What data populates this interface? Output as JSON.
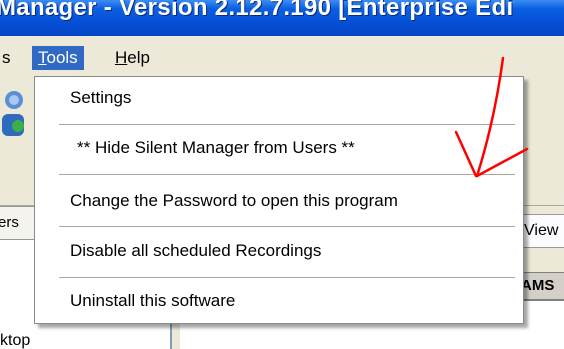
{
  "window": {
    "title": "Manager - Version 2.12.7.190  [Enterprise Edi"
  },
  "menubar": {
    "items": [
      {
        "label": "s",
        "mnemonic": ""
      },
      {
        "label": "Tools",
        "mnemonic": "T"
      },
      {
        "label": "Help",
        "mnemonic": "H"
      }
    ],
    "active": "Tools"
  },
  "tools_menu": {
    "items": [
      {
        "label": "Settings"
      },
      {
        "label": "** Hide Silent Manager from Users **"
      },
      {
        "label": "Change the Password to open this program"
      },
      {
        "label": "Disable all scheduled Recordings"
      },
      {
        "label": "Uninstall this software"
      }
    ]
  },
  "background": {
    "left_tab_label": "ers",
    "left_item": "sktop",
    "right_tab_label": "View",
    "column_header": "AMS"
  },
  "annotation": {
    "arrow_color": "#ff0000"
  }
}
